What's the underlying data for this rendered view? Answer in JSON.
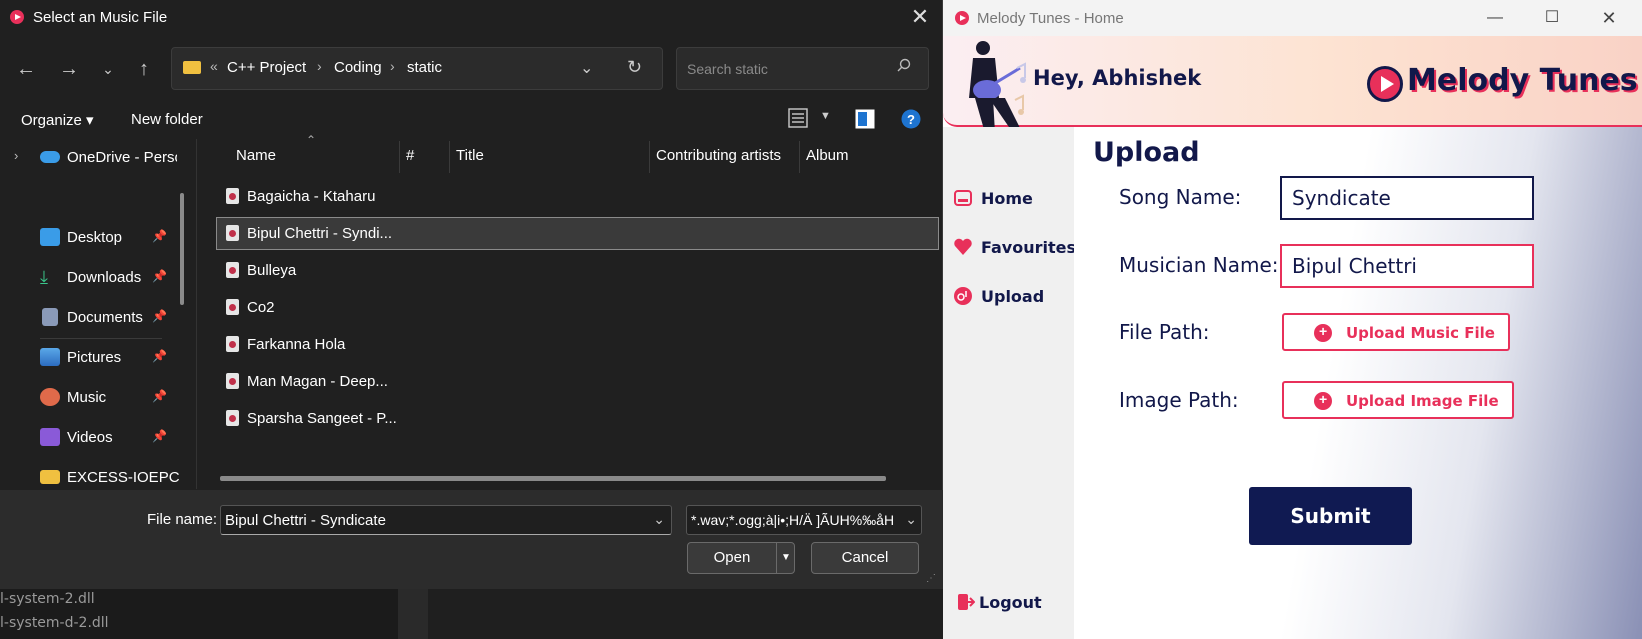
{
  "background": {
    "lines": [
      "l-system-2.dll",
      "l-system-d-2.dll"
    ]
  },
  "dialog": {
    "title": "Select an Music File",
    "address": {
      "overflow": "«",
      "crumbs": [
        "C++ Project",
        "Coding",
        "static"
      ]
    },
    "search_placeholder": "Search static",
    "toolbar": {
      "organize": "Organize ▾",
      "new_folder": "New folder"
    },
    "sidebar": [
      {
        "label": "OneDrive - Perso",
        "icon": "onedrive-icon"
      },
      {
        "label": "Desktop",
        "icon": "desktop-icon"
      },
      {
        "label": "Downloads",
        "icon": "downloads-icon"
      },
      {
        "label": "Documents",
        "icon": "documents-icon"
      },
      {
        "label": "Pictures",
        "icon": "pictures-icon"
      },
      {
        "label": "Music",
        "icon": "music-icon"
      },
      {
        "label": "Videos",
        "icon": "videos-icon"
      },
      {
        "label": "EXCESS-IOEPC",
        "icon": "folder-icon"
      }
    ],
    "columns": [
      "Name",
      "#",
      "Title",
      "Contributing artists",
      "Album"
    ],
    "files": [
      "Bagaicha - Ktaharu",
      "Bipul Chettri - Syndi...",
      "Bulleya",
      "Co2",
      "Farkanna Hola",
      "Man Magan - Deep...",
      "Sparsha Sangeet - P..."
    ],
    "selected_index": 1,
    "file_name_label": "File name:",
    "file_name_value": "Bipul Chettri - Syndicate",
    "file_type_value": "*.wav;*.ogg;à|i•;H/Ä ]ÃUH%‰åH",
    "open": "Open",
    "cancel": "Cancel"
  },
  "app": {
    "title": "Melody Tunes - Home",
    "greeting": "Hey, Abhishek",
    "brand": "Melody Tunes",
    "nav": [
      {
        "label": "Home",
        "icon": "home-icon"
      },
      {
        "label": "Favourites",
        "icon": "heart-icon"
      },
      {
        "label": "Upload",
        "icon": "upload-icon"
      }
    ],
    "logout": "Logout",
    "page_title": "Upload",
    "form": {
      "song_label": "Song Name:",
      "song_value": "Syndicate",
      "musician_label": "Musician Name:",
      "musician_value": "Bipul Chettri",
      "file_label": "File Path:",
      "file_button": "Upload Music File",
      "image_label": "Image Path:",
      "image_button": "Upload Image File",
      "submit": "Submit"
    },
    "colors": {
      "accent": "#e8305a",
      "navy": "#101a52"
    }
  }
}
